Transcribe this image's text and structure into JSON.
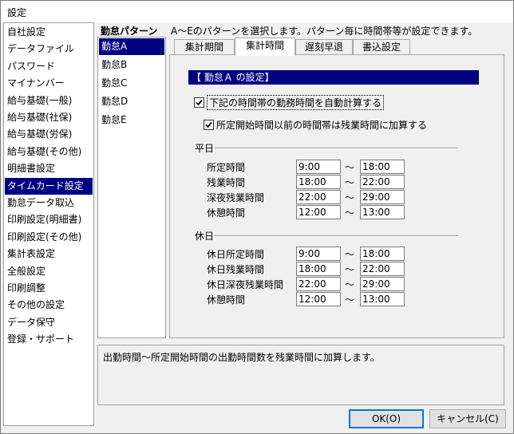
{
  "window": {
    "title": "設定"
  },
  "menu": {
    "items": [
      "自社設定",
      "データファイル",
      "パスワード",
      "マイナンバー",
      "給与基礎(一般)",
      "給与基礎(社保)",
      "給与基礎(労保)",
      "給与基礎(その他)",
      "明細書設定",
      "タイムカード設定",
      "勤怠データ取込",
      "印刷設定(明細書)",
      "印刷設定(その他)",
      "集計表設定",
      "全般設定",
      "印刷調整",
      "その他の設定",
      "データ保守",
      "登録・サポート"
    ],
    "selected_index": 9
  },
  "section": {
    "label": "勤怠パターン",
    "description": "A～Eのパターンを選択します。パターン毎に時間帯等が設定できます。"
  },
  "patterns": {
    "items": [
      "勤怠A",
      "勤怠B",
      "勤怠C",
      "勤怠D",
      "勤怠E"
    ],
    "selected_index": 0
  },
  "tabs": {
    "items": [
      "集計期間",
      "集計時間",
      "遅刻早退",
      "書込設定"
    ],
    "active_index": 1
  },
  "panel": {
    "header": "【 勤怠Ａ の設定】",
    "auto_calc": {
      "label": "下記の時間帯の勤務時間を自動計算する",
      "checked": true
    },
    "add_overtime": {
      "label": "所定開始時間以前の時間帯は残業時間に加算する",
      "checked": true
    },
    "tilde": "～",
    "weekday": {
      "title": "平日",
      "rows": [
        {
          "label": "所定時間",
          "start": "9:00",
          "end": "18:00"
        },
        {
          "label": "残業時間",
          "start": "18:00",
          "end": "22:00"
        },
        {
          "label": "深夜残業時間",
          "start": "22:00",
          "end": "29:00"
        },
        {
          "label": "休憩時間",
          "start": "12:00",
          "end": "13:00"
        }
      ]
    },
    "holiday": {
      "title": "休日",
      "rows": [
        {
          "label": "休日所定時間",
          "start": "9:00",
          "end": "18:00"
        },
        {
          "label": "休日残業時間",
          "start": "18:00",
          "end": "22:00"
        },
        {
          "label": "休日深夜残業時間",
          "start": "22:00",
          "end": "29:00"
        },
        {
          "label": "休憩時間",
          "start": "12:00",
          "end": "13:00"
        }
      ]
    }
  },
  "hint": {
    "text": "出勤時間～所定開始時間の出勤時間数を残業時間に加算します。"
  },
  "buttons": {
    "ok": "OK(O)",
    "cancel": "キャンセル(C)"
  },
  "colors": {
    "selection": "#000080",
    "background": "#f0f0f0",
    "accent": "#0078d7"
  }
}
